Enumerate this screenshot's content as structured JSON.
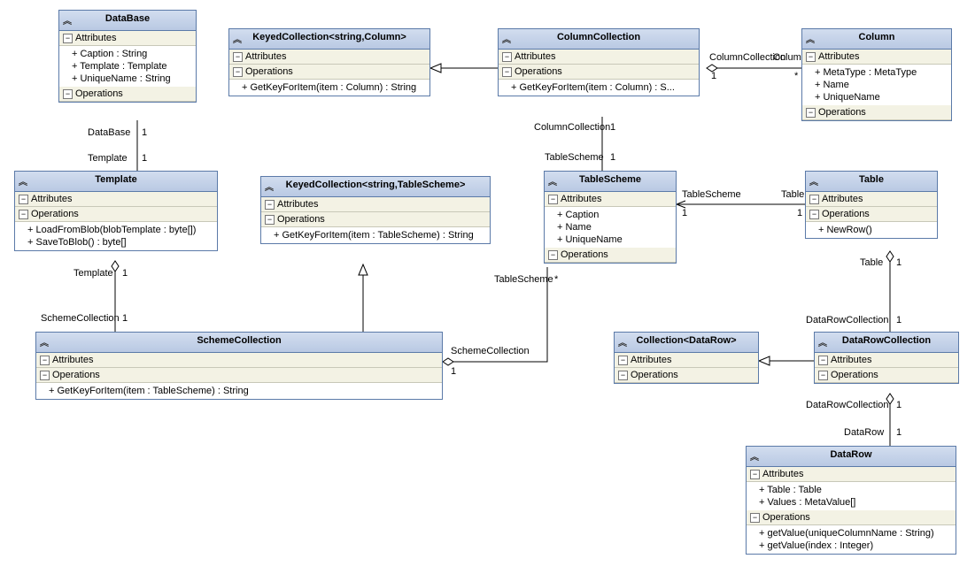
{
  "labels": {
    "attributes": "Attributes",
    "operations": "Operations"
  },
  "classes": {
    "database": {
      "name": "DataBase",
      "attrs": [
        "Caption : String",
        "Template : Template",
        "UniqueName : String"
      ]
    },
    "keyedCollectionColumn": {
      "name": "KeyedCollection<string,Column>",
      "ops": [
        "GetKeyForItem(item : Column) : String"
      ]
    },
    "columnCollection": {
      "name": "ColumnCollection",
      "ops": [
        "GetKeyForItem(item : Column) : S..."
      ]
    },
    "column": {
      "name": "Column",
      "attrs": [
        "MetaType : MetaType",
        "Name",
        "UniqueName"
      ]
    },
    "template": {
      "name": "Template",
      "ops": [
        "LoadFromBlob(blobTemplate : byte[])",
        "SaveToBlob() : byte[]"
      ]
    },
    "keyedCollectionTableScheme": {
      "name": "KeyedCollection<string,TableScheme>",
      "ops": [
        "GetKeyForItem(item : TableScheme) : String"
      ]
    },
    "tableScheme": {
      "name": "TableScheme",
      "attrs": [
        "Caption",
        "Name",
        "UniqueName"
      ]
    },
    "table": {
      "name": "Table",
      "ops": [
        "NewRow()"
      ]
    },
    "schemeCollection": {
      "name": "SchemeCollection",
      "ops": [
        "GetKeyForItem(item : TableScheme) : String"
      ]
    },
    "collectionDataRow": {
      "name": "Collection<DataRow>"
    },
    "dataRowCollection": {
      "name": "DataRowCollection"
    },
    "dataRow": {
      "name": "DataRow",
      "attrs": [
        "Table : Table",
        "Values : MetaValue[]"
      ],
      "ops": [
        "getValue(uniqueColumnName : String)",
        "getValue(index : Integer)"
      ]
    }
  },
  "connLabels": {
    "db_database": "DataBase",
    "db_template": "Template",
    "one": "1",
    "star": "*",
    "columnCollection": "ColumnCollection",
    "column": "Column",
    "tableScheme": "TableScheme",
    "template": "Template",
    "schemeCollection": "SchemeCollection",
    "table": "Table",
    "dataRowCollection": "DataRowCollection",
    "dataRow": "DataRow"
  }
}
